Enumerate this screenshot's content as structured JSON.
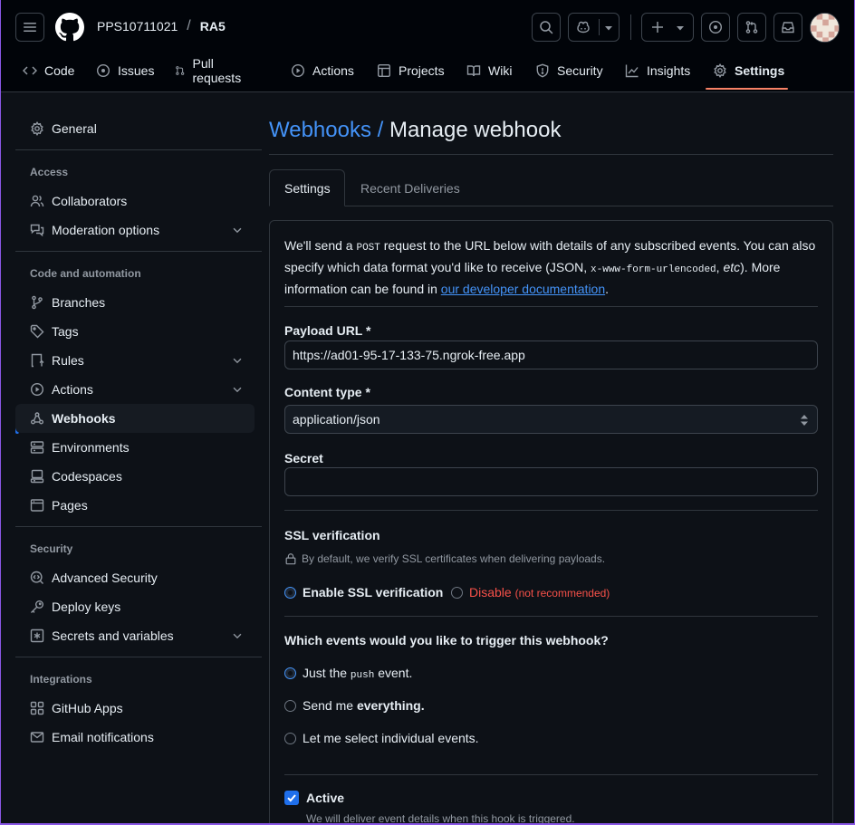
{
  "header": {
    "owner": "PPS10711021",
    "separator": "/",
    "repo": "RA5"
  },
  "repo_tabs": [
    {
      "label": "Code",
      "icon": "code-icon"
    },
    {
      "label": "Issues",
      "icon": "issue-icon"
    },
    {
      "label": "Pull requests",
      "icon": "pull-request-icon"
    },
    {
      "label": "Actions",
      "icon": "play-icon"
    },
    {
      "label": "Projects",
      "icon": "table-icon"
    },
    {
      "label": "Wiki",
      "icon": "book-icon"
    },
    {
      "label": "Security",
      "icon": "shield-icon"
    },
    {
      "label": "Insights",
      "icon": "graph-icon"
    },
    {
      "label": "Settings",
      "icon": "gear-icon",
      "selected": true
    }
  ],
  "sidebar": {
    "general": "General",
    "access_heading": "Access",
    "collaborators": "Collaborators",
    "moderation": "Moderation options",
    "code_heading": "Code and automation",
    "branches": "Branches",
    "tags": "Tags",
    "rules": "Rules",
    "actions": "Actions",
    "webhooks": "Webhooks",
    "environments": "Environments",
    "codespaces": "Codespaces",
    "pages": "Pages",
    "security_heading": "Security",
    "advanced_security": "Advanced Security",
    "deploy_keys": "Deploy keys",
    "secrets": "Secrets and variables",
    "integrations_heading": "Integrations",
    "github_apps": "GitHub Apps",
    "email_notifications": "Email notifications"
  },
  "main": {
    "title_link": "Webhooks /",
    "title": "Manage webhook",
    "tab_settings": "Settings",
    "tab_deliveries": "Recent Deliveries",
    "intro_1": "We'll send a ",
    "intro_post": "POST",
    "intro_2": " request to the URL below with details of any subscribed events. You can also specify which data format you'd like to receive (JSON, ",
    "intro_form": "x-www-form-urlencoded",
    "intro_3": ", ",
    "intro_etc": "etc",
    "intro_4": "). More information can be found in ",
    "intro_link": "our developer documentation",
    "intro_5": ".",
    "payload_label": "Payload URL *",
    "payload_value": "https://ad01-95-17-133-75.ngrok-free.app",
    "content_label": "Content type *",
    "content_value": "application/json",
    "secret_label": "Secret",
    "secret_value": "",
    "ssl_heading": "SSL verification",
    "ssl_note": "By default, we verify SSL certificates when delivering payloads.",
    "ssl_enable": "Enable SSL verification",
    "ssl_disable": "Disable",
    "ssl_disable_note": "(not recommended)",
    "events_heading": "Which events would you like to trigger this webhook?",
    "events_just_1": "Just the",
    "events_push": "push",
    "events_just_2": "event.",
    "events_everything_1": "Send me",
    "events_everything_2": "everything.",
    "events_individual": "Let me select individual events.",
    "active_label": "Active",
    "active_note": "We will deliver event details when this hook is triggered."
  },
  "colors": {
    "accent": "#4493f8",
    "danger": "#f85149",
    "selected_tab_underline": "#f78166"
  }
}
